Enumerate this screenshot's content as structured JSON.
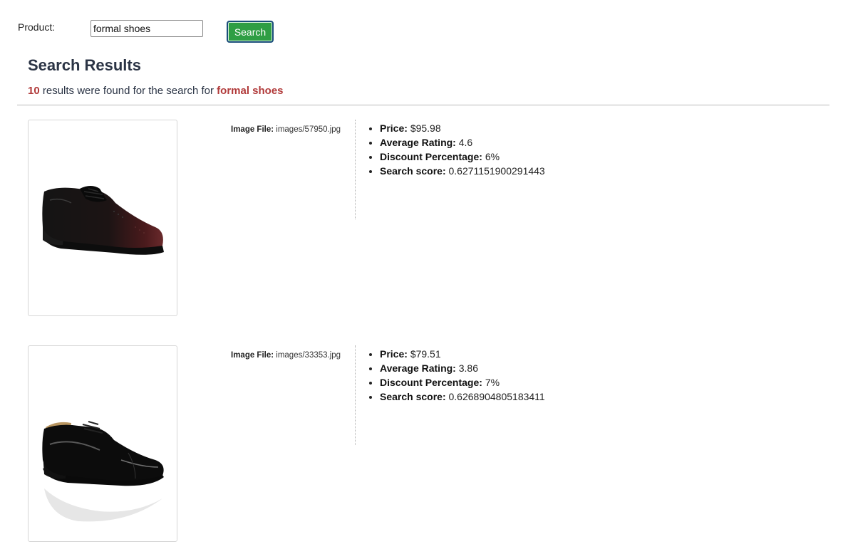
{
  "search": {
    "label": "Product:",
    "value": "formal shoes",
    "button_label": "Search"
  },
  "results": {
    "title": "Search Results",
    "count": "10",
    "summary_text": "results were found for the search for",
    "query": "formal shoes"
  },
  "items": [
    {
      "image_file_label": "Image File:",
      "image_file": "images/57950.jpg",
      "image_icon": "formal-shoe-burgundy",
      "price_label": "Price:",
      "price": "$95.98",
      "rating_label": "Average Rating:",
      "rating": "4.6",
      "discount_label": "Discount Percentage:",
      "discount": "6%",
      "score_label": "Search score:",
      "score": "0.6271151900291443"
    },
    {
      "image_file_label": "Image File:",
      "image_file": "images/33353.jpg",
      "image_icon": "formal-shoe-patent-black",
      "price_label": "Price:",
      "price": "$79.51",
      "rating_label": "Average Rating:",
      "rating": "3.86",
      "discount_label": "Discount Percentage:",
      "discount": "7%",
      "score_label": "Search score:",
      "score": "0.6268904805183411"
    }
  ],
  "colors": {
    "accent_red": "#b13a3a",
    "button_green": "#2f9e44",
    "heading": "#2b3445"
  }
}
